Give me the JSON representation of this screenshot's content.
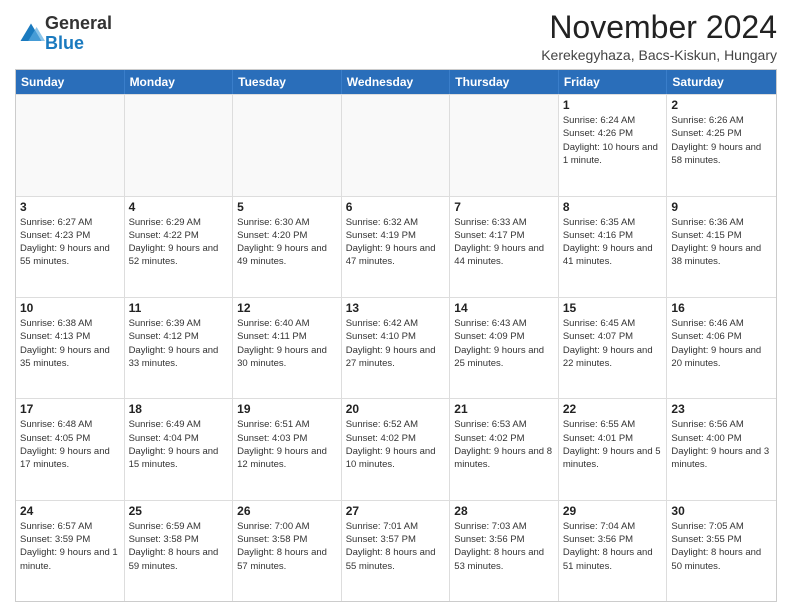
{
  "logo": {
    "general": "General",
    "blue": "Blue"
  },
  "title": "November 2024",
  "subtitle": "Kerekegyhaza, Bacs-Kiskun, Hungary",
  "header_days": [
    "Sunday",
    "Monday",
    "Tuesday",
    "Wednesday",
    "Thursday",
    "Friday",
    "Saturday"
  ],
  "weeks": [
    [
      {
        "day": "",
        "info": ""
      },
      {
        "day": "",
        "info": ""
      },
      {
        "day": "",
        "info": ""
      },
      {
        "day": "",
        "info": ""
      },
      {
        "day": "",
        "info": ""
      },
      {
        "day": "1",
        "info": "Sunrise: 6:24 AM\nSunset: 4:26 PM\nDaylight: 10 hours and 1 minute."
      },
      {
        "day": "2",
        "info": "Sunrise: 6:26 AM\nSunset: 4:25 PM\nDaylight: 9 hours and 58 minutes."
      }
    ],
    [
      {
        "day": "3",
        "info": "Sunrise: 6:27 AM\nSunset: 4:23 PM\nDaylight: 9 hours and 55 minutes."
      },
      {
        "day": "4",
        "info": "Sunrise: 6:29 AM\nSunset: 4:22 PM\nDaylight: 9 hours and 52 minutes."
      },
      {
        "day": "5",
        "info": "Sunrise: 6:30 AM\nSunset: 4:20 PM\nDaylight: 9 hours and 49 minutes."
      },
      {
        "day": "6",
        "info": "Sunrise: 6:32 AM\nSunset: 4:19 PM\nDaylight: 9 hours and 47 minutes."
      },
      {
        "day": "7",
        "info": "Sunrise: 6:33 AM\nSunset: 4:17 PM\nDaylight: 9 hours and 44 minutes."
      },
      {
        "day": "8",
        "info": "Sunrise: 6:35 AM\nSunset: 4:16 PM\nDaylight: 9 hours and 41 minutes."
      },
      {
        "day": "9",
        "info": "Sunrise: 6:36 AM\nSunset: 4:15 PM\nDaylight: 9 hours and 38 minutes."
      }
    ],
    [
      {
        "day": "10",
        "info": "Sunrise: 6:38 AM\nSunset: 4:13 PM\nDaylight: 9 hours and 35 minutes."
      },
      {
        "day": "11",
        "info": "Sunrise: 6:39 AM\nSunset: 4:12 PM\nDaylight: 9 hours and 33 minutes."
      },
      {
        "day": "12",
        "info": "Sunrise: 6:40 AM\nSunset: 4:11 PM\nDaylight: 9 hours and 30 minutes."
      },
      {
        "day": "13",
        "info": "Sunrise: 6:42 AM\nSunset: 4:10 PM\nDaylight: 9 hours and 27 minutes."
      },
      {
        "day": "14",
        "info": "Sunrise: 6:43 AM\nSunset: 4:09 PM\nDaylight: 9 hours and 25 minutes."
      },
      {
        "day": "15",
        "info": "Sunrise: 6:45 AM\nSunset: 4:07 PM\nDaylight: 9 hours and 22 minutes."
      },
      {
        "day": "16",
        "info": "Sunrise: 6:46 AM\nSunset: 4:06 PM\nDaylight: 9 hours and 20 minutes."
      }
    ],
    [
      {
        "day": "17",
        "info": "Sunrise: 6:48 AM\nSunset: 4:05 PM\nDaylight: 9 hours and 17 minutes."
      },
      {
        "day": "18",
        "info": "Sunrise: 6:49 AM\nSunset: 4:04 PM\nDaylight: 9 hours and 15 minutes."
      },
      {
        "day": "19",
        "info": "Sunrise: 6:51 AM\nSunset: 4:03 PM\nDaylight: 9 hours and 12 minutes."
      },
      {
        "day": "20",
        "info": "Sunrise: 6:52 AM\nSunset: 4:02 PM\nDaylight: 9 hours and 10 minutes."
      },
      {
        "day": "21",
        "info": "Sunrise: 6:53 AM\nSunset: 4:02 PM\nDaylight: 9 hours and 8 minutes."
      },
      {
        "day": "22",
        "info": "Sunrise: 6:55 AM\nSunset: 4:01 PM\nDaylight: 9 hours and 5 minutes."
      },
      {
        "day": "23",
        "info": "Sunrise: 6:56 AM\nSunset: 4:00 PM\nDaylight: 9 hours and 3 minutes."
      }
    ],
    [
      {
        "day": "24",
        "info": "Sunrise: 6:57 AM\nSunset: 3:59 PM\nDaylight: 9 hours and 1 minute."
      },
      {
        "day": "25",
        "info": "Sunrise: 6:59 AM\nSunset: 3:58 PM\nDaylight: 8 hours and 59 minutes."
      },
      {
        "day": "26",
        "info": "Sunrise: 7:00 AM\nSunset: 3:58 PM\nDaylight: 8 hours and 57 minutes."
      },
      {
        "day": "27",
        "info": "Sunrise: 7:01 AM\nSunset: 3:57 PM\nDaylight: 8 hours and 55 minutes."
      },
      {
        "day": "28",
        "info": "Sunrise: 7:03 AM\nSunset: 3:56 PM\nDaylight: 8 hours and 53 minutes."
      },
      {
        "day": "29",
        "info": "Sunrise: 7:04 AM\nSunset: 3:56 PM\nDaylight: 8 hours and 51 minutes."
      },
      {
        "day": "30",
        "info": "Sunrise: 7:05 AM\nSunset: 3:55 PM\nDaylight: 8 hours and 50 minutes."
      }
    ]
  ]
}
